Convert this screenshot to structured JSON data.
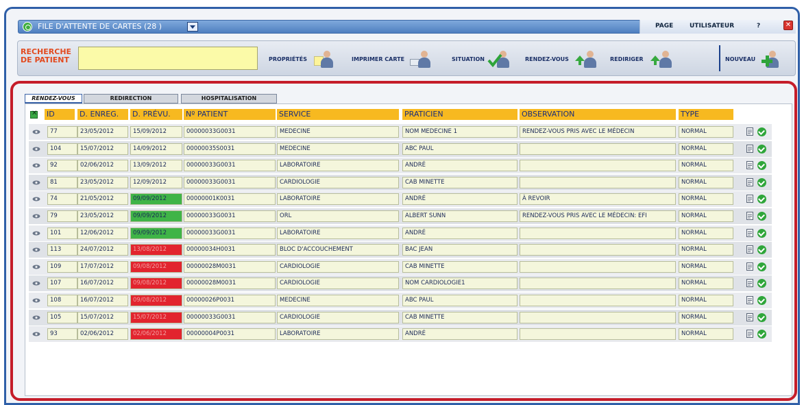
{
  "window": {
    "title": "FILE D'ATTENTE DE CARTES (28 )"
  },
  "menu": {
    "page": "PAGE",
    "user": "UTILISATEUR",
    "help": "?"
  },
  "search": {
    "label_line1": "RECHERCHE",
    "label_line2": "DE PATIENT",
    "value": ""
  },
  "toolbar": {
    "properties": "PROPRIÉTÉS",
    "print_card": "IMPRIMER CARTE",
    "situation": "SITUATION",
    "appointments": "RENDEZ-VOUS",
    "redirect": "REDIRIGER",
    "new": "NOUVEAU"
  },
  "tabs": [
    {
      "label": "RENDEZ-VOUS",
      "active": true
    },
    {
      "label": "REDIRECTION",
      "active": false
    },
    {
      "label": "HOSPITALISATION",
      "active": false
    }
  ],
  "columns": [
    "ID",
    "D. ENREG.",
    "D. PRÉVU.",
    "Nº PATIENT",
    "SERVICE",
    "PRATICIEN",
    "OBSERVATION",
    "TYPE"
  ],
  "status_colors": {
    "green": "#3fb447",
    "red": "#e2242e"
  },
  "rows": [
    {
      "id": "77",
      "reg": "23/05/2012",
      "due": "15/09/2012",
      "due_status": "normal",
      "patient": "00000033G0031",
      "service": "MEDECINE",
      "practitioner": "NOM MEDECINE 1",
      "observation": "RENDEZ-VOUS PRIS AVEC LE MÉDECIN",
      "type": "NORMAL"
    },
    {
      "id": "104",
      "reg": "15/07/2012",
      "due": "14/09/2012",
      "due_status": "normal",
      "patient": "00000035S0031",
      "service": "MEDECINE",
      "practitioner": "ABC PAUL",
      "observation": "",
      "type": "NORMAL"
    },
    {
      "id": "92",
      "reg": "02/06/2012",
      "due": "13/09/2012",
      "due_status": "normal",
      "patient": "00000033G0031",
      "service": "LABORATOIRE",
      "practitioner": "ANDRÉ",
      "observation": "",
      "type": "NORMAL"
    },
    {
      "id": "81",
      "reg": "23/05/2012",
      "due": "12/09/2012",
      "due_status": "normal",
      "patient": "00000033G0031",
      "service": "CARDIOLOGIE",
      "practitioner": "CAB MINETTE",
      "observation": "",
      "type": "NORMAL"
    },
    {
      "id": "74",
      "reg": "21/05/2012",
      "due": "09/09/2012",
      "due_status": "green",
      "patient": "00000001K0031",
      "service": "LABORATOIRE",
      "practitioner": "ANDRÉ",
      "observation": "À REVOIR",
      "type": "NORMAL"
    },
    {
      "id": "79",
      "reg": "23/05/2012",
      "due": "09/09/2012",
      "due_status": "green",
      "patient": "00000033G0031",
      "service": "ORL",
      "practitioner": "ALBERT SUNN",
      "observation": "RENDEZ-VOUS PRIS AVEC LE MÉDECIN: EFI",
      "type": "NORMAL"
    },
    {
      "id": "101",
      "reg": "12/06/2012",
      "due": "09/09/2012",
      "due_status": "green",
      "patient": "00000033G0031",
      "service": "LABORATOIRE",
      "practitioner": "ANDRÉ",
      "observation": "",
      "type": "NORMAL"
    },
    {
      "id": "113",
      "reg": "24/07/2012",
      "due": "13/08/2012",
      "due_status": "red",
      "patient": "00000034H0031",
      "service": "BLOC D'ACCOUCHEMENT",
      "practitioner": "BAC JEAN",
      "observation": "",
      "type": "NORMAL"
    },
    {
      "id": "109",
      "reg": "17/07/2012",
      "due": "09/08/2012",
      "due_status": "red",
      "patient": "00000028M0031",
      "service": "CARDIOLOGIE",
      "practitioner": "CAB MINETTE",
      "observation": "",
      "type": "NORMAL"
    },
    {
      "id": "107",
      "reg": "16/07/2012",
      "due": "09/08/2012",
      "due_status": "red",
      "patient": "00000028M0031",
      "service": "CARDIOLOGIE",
      "practitioner": "NOM CARDIOLOGIE1",
      "observation": "",
      "type": "NORMAL"
    },
    {
      "id": "108",
      "reg": "16/07/2012",
      "due": "09/08/2012",
      "due_status": "red",
      "patient": "00000026P0031",
      "service": "MEDECINE",
      "practitioner": "ABC PAUL",
      "observation": "",
      "type": "NORMAL"
    },
    {
      "id": "105",
      "reg": "15/07/2012",
      "due": "15/07/2012",
      "due_status": "red",
      "patient": "00000033G0031",
      "service": "CARDIOLOGIE",
      "practitioner": "CAB MINETTE",
      "observation": "",
      "type": "NORMAL"
    },
    {
      "id": "93",
      "reg": "02/06/2012",
      "due": "02/06/2012",
      "due_status": "red",
      "patient": "00000004P0031",
      "service": "LABORATOIRE",
      "practitioner": "ANDRÉ",
      "observation": "",
      "type": "NORMAL"
    }
  ]
}
